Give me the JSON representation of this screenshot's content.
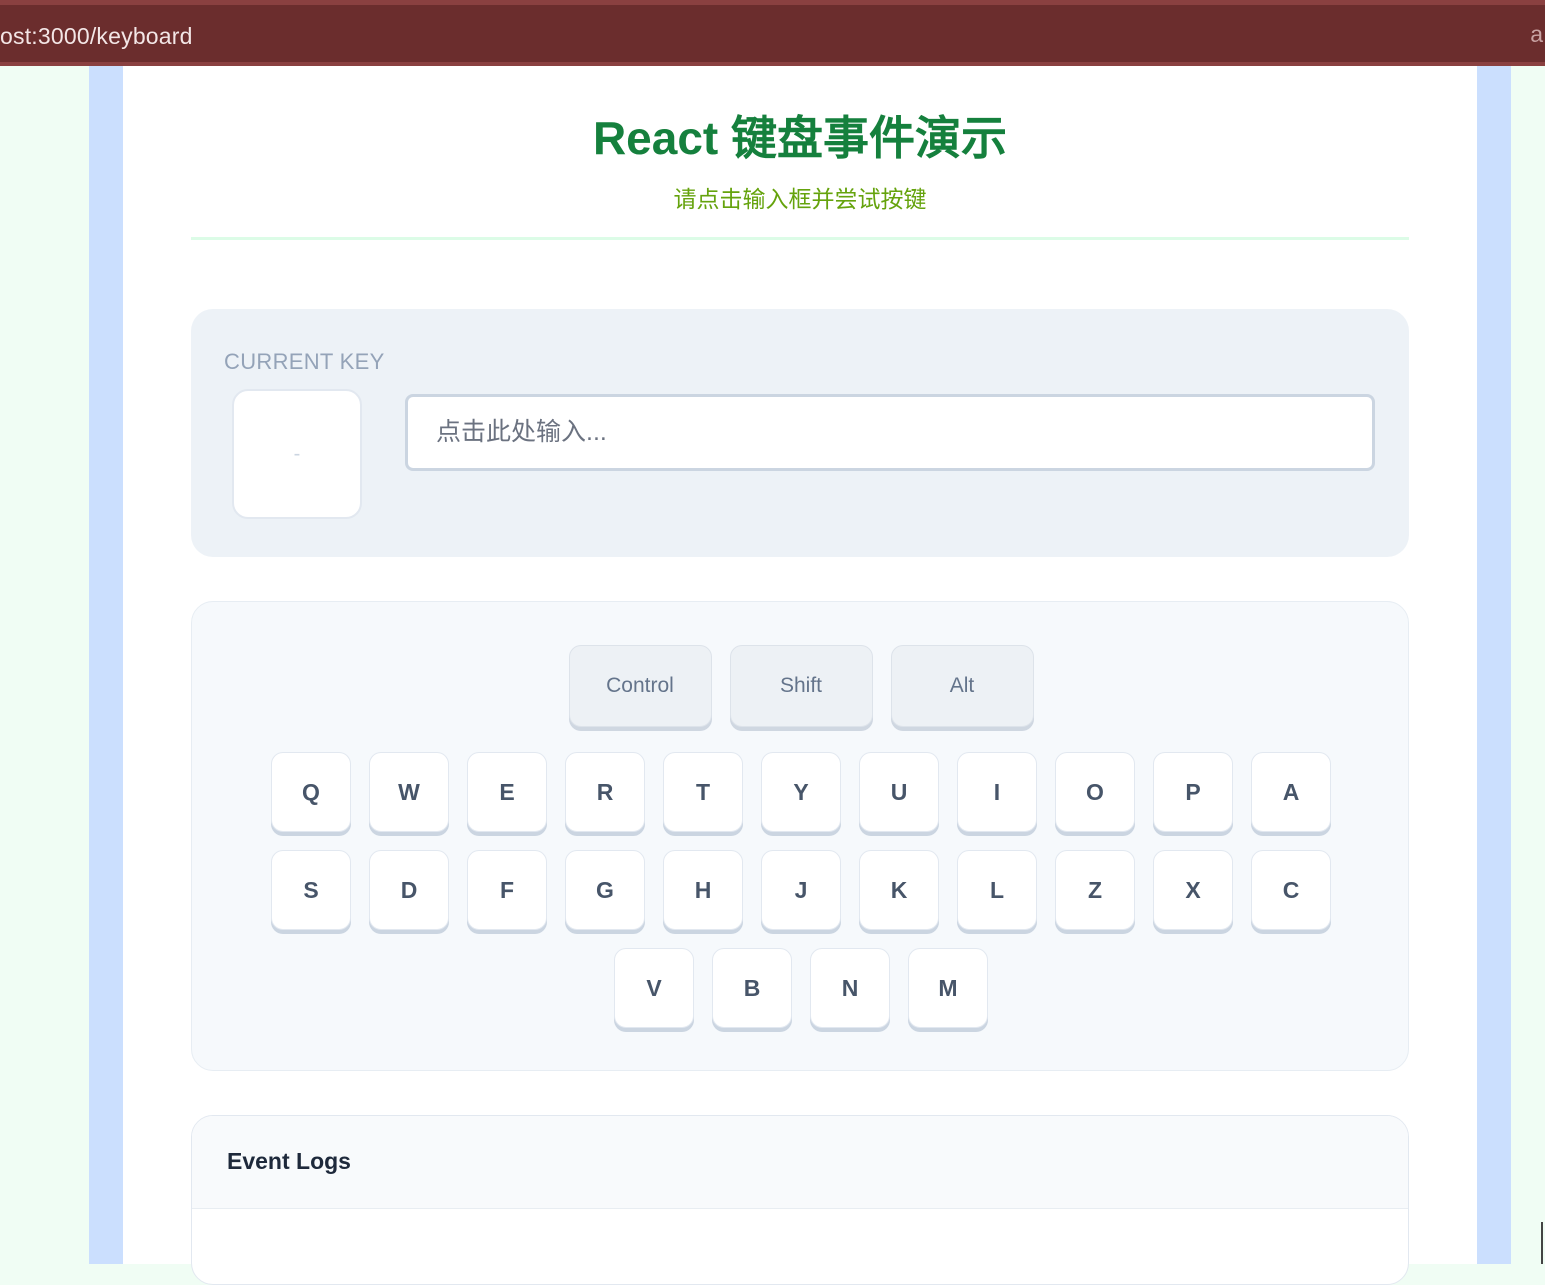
{
  "browser": {
    "url": "ost:3000/keyboard",
    "right_edge_text": "a"
  },
  "header": {
    "title": "React 键盘事件演示",
    "subtitle": "请点击输入框并尝试按键"
  },
  "current_key": {
    "label": "CURRENT KEY",
    "value": "-",
    "input_placeholder": "点击此处输入...",
    "input_value": ""
  },
  "keyboard": {
    "modifiers": [
      "Control",
      "Shift",
      "Alt"
    ],
    "rows": [
      [
        "Q",
        "W",
        "E",
        "R",
        "T",
        "Y",
        "U",
        "I",
        "O",
        "P",
        "A"
      ],
      [
        "S",
        "D",
        "F",
        "G",
        "H",
        "J",
        "K",
        "L",
        "Z",
        "X",
        "C"
      ],
      [
        "V",
        "B",
        "N",
        "M"
      ]
    ]
  },
  "logs": {
    "title": "Event Logs",
    "entries": []
  },
  "colors": {
    "title": "#15803d",
    "subtitle": "#65a30d",
    "url_bar": "#6b2d2d",
    "side_strip": "#cbdffe",
    "page_background": "#f0fdf4"
  }
}
